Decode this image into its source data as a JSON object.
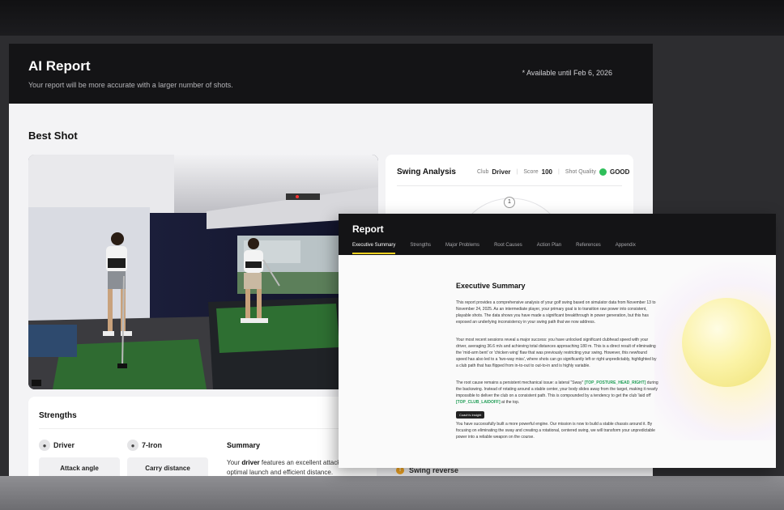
{
  "ai_report": {
    "title": "AI Report",
    "subtitle": "Your report will be more accurate with a larger number of shots.",
    "available_until": "* Available until Feb 6, 2026",
    "best_shot_title": "Best Shot"
  },
  "swing_analysis": {
    "title": "Swing Analysis",
    "club_label": "Club",
    "club_value": "Driver",
    "score_label": "Score",
    "score_value": "100",
    "quality_label": "Shot Quality",
    "quality_value": "GOOD",
    "gauge_marker": "1",
    "good_color": "#2fbf5a"
  },
  "strengths": {
    "title": "Strengths",
    "clubs": [
      {
        "name": "Driver",
        "metric": "Attack angle"
      },
      {
        "name": "7-Iron",
        "metric": "Carry distance"
      }
    ],
    "summary_title": "Summary",
    "summary_pre": "Your ",
    "summary_bold": "driver",
    "summary_post": " features an excellent attack a producing optimal launch and efficient distance."
  },
  "problem_item": {
    "label": "Swing reverse",
    "icon": "warning-icon"
  },
  "report": {
    "title": "Report",
    "tabs": [
      "Executive Summary",
      "Strengths",
      "Major Problems",
      "Root Causes",
      "Action Plan",
      "References",
      "Appendix"
    ],
    "accent_color": "#f5d020",
    "section_title": "Executive Summary",
    "para1": "This report provides a comprehensive analysis of your golf swing based on simulator data from November 13 to November 24, 2025. As an intermediate player, your primary goal is to transition raw power into consistent, playable shots. The data shows you have made a significant breakthrough in power generation, but this has exposed an underlying inconsistency in your swing path that we now address.",
    "para2": "Your most recent sessions reveal a major success: you have unlocked significant clubhead speed with your driver, averaging 36.6 m/s and achieving total distances approaching 180 m. This is a direct result of eliminating the 'mid-arm bent' or 'chicken wing' flaw that was previously restricting your swing. However, this newfound speed has also led to a 'two-way miss', where shots can go significantly left or right unpredictably, highlighted by a club path that has flipped from in-to-out to out-to-in and is highly variable.",
    "para3_pre": "The root cause remains a persistent mechanical issue: a lateral \"Sway\" ",
    "para3_code1": "[TOP_POSTURE_HEAD_RIGHT]",
    "para3_mid": " during the backswing. Instead of rotating around a stable center, your body slides away from the target, making it nearly impossible to deliver the club on a consistent path. This is compounded by a tendency to get the club 'laid off' ",
    "para3_code2": "[TOP_CLUB_LAIDOFF]",
    "para3_post": " at the top.",
    "coach_button": "Coach's Insight",
    "para4": "You have successfully built a more powerful engine. Our mission is now to build a stable chassis around it. By focusing on eliminating the sway and creating a rotational, centered swing, we will transform your unpredictable power into a reliable weapon on the course."
  }
}
